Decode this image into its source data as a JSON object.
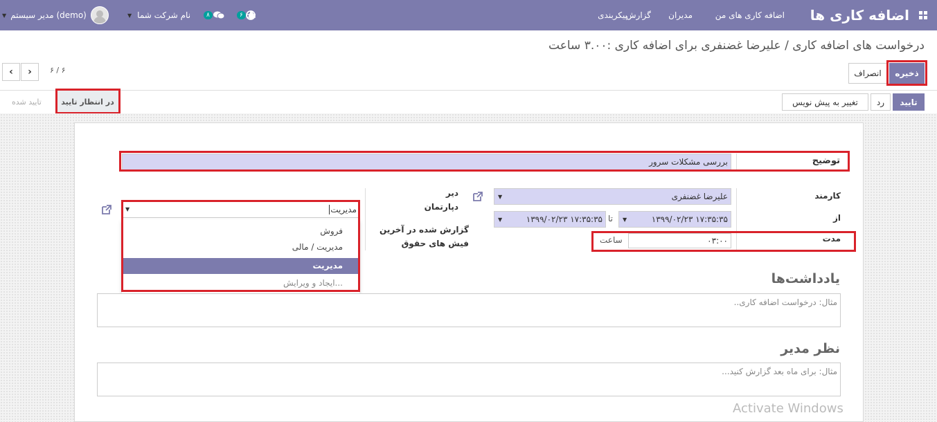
{
  "navbar": {
    "brand": "اضافه کاری ها",
    "menu": [
      "اضافه کاری های من",
      "مدیران",
      "گزارش",
      "پیکربندی"
    ],
    "activity_badge": "۶",
    "messages_badge": "۸",
    "company": "نام شرکت شما",
    "user": "مدیر سیستم (demo)",
    "accent_color": "#7c7bad"
  },
  "breadcrumb": {
    "parent": "درخواست های اضافه کاری",
    "separator": "/",
    "current": "علیرضا غضنفری برای اضافه کاری :۳.۰۰ ساعت"
  },
  "actions": {
    "save": "ذخیره",
    "discard": "انصراف"
  },
  "pager": {
    "text": "۶ / ۶"
  },
  "workflow": {
    "approve": "تایید",
    "refuse": "رد",
    "reset_draft": "تغییر به پیش نویس",
    "states": [
      "در انتظار تایید",
      "تایید شده"
    ]
  },
  "form": {
    "description_label": "توضیح",
    "description_value": "بررسی مشکلات سرور",
    "employee_label": "کارمند",
    "employee_value": "علیرضا غضنفری",
    "from_label": "از",
    "date_from": "۱۳۹۹/۰۲/۲۳ ۱۷:۳۵:۳۵",
    "to_label": "تا",
    "date_to": "۱۳۹۹/۰۲/۲۳ ۱۷:۳۵:۳۵",
    "duration_label": "مدت",
    "duration_value": "۰۳:۰۰",
    "duration_unit": "ساعت",
    "department_label_line1": "دیر",
    "department_label_line2": "دپارتمان",
    "reported_label_line1": "گزارش شده در آخرین",
    "reported_label_line2": "فیش های حقوق",
    "department_input": "مدیریت",
    "department_options": [
      "فروش",
      "مدیریت / مالی",
      "مدیریت"
    ],
    "create_edit": "ایجاد و ویرایش..."
  },
  "notes": {
    "title": "یادداشت‌ها",
    "placeholder": "مثال: درخواست اضافه کاری.."
  },
  "manager": {
    "title": "نظر مدیر",
    "placeholder": "مثال: برای ماه بعد گزارش کنید..."
  },
  "watermark": "Activate Windows"
}
